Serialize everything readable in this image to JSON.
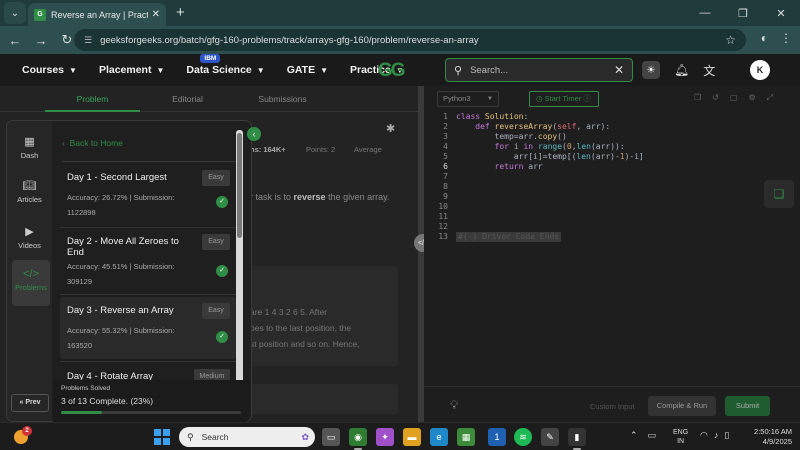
{
  "browser": {
    "tab_title": "Reverse an Array | Practice | Gee",
    "url": "geeksforgeeks.org/batch/gfg-160-problems/track/arrays-gfg-160/problem/reverse-an-array"
  },
  "header": {
    "nav": [
      {
        "label": "Courses"
      },
      {
        "label": "Placement"
      },
      {
        "label": "Data Science"
      },
      {
        "label": "GATE"
      },
      {
        "label": "Practice"
      }
    ],
    "ibm_badge": "IBM",
    "logo_text": "GG",
    "search_placeholder": "Search...",
    "avatar_letter": "K"
  },
  "problem": {
    "tabs": [
      "Problem",
      "Editorial",
      "Submissions"
    ],
    "submissions_label": "ns: 164K+",
    "points_label": "Points: 2",
    "average_label": "Average",
    "statement_pre": "r task is to ",
    "statement_bold": "reverse",
    "statement_post": " the given array.",
    "example_lines": [
      "are 1 4 3 2 6 5. After",
      "oes to the last position, the",
      "st position and so on. Hence,"
    ]
  },
  "editor": {
    "language": "Python3",
    "start_timer": "Start Timer",
    "line_numbers": [
      "1",
      "2",
      "3",
      "4",
      "5",
      "6",
      "7",
      "8",
      "9",
      "10",
      "11",
      "12",
      "13"
    ],
    "ghost_comment": "#{ } Driver Code Ends",
    "custom_input": "Custom Input",
    "compile_label": "Compile & Run",
    "submit_label": "Submit"
  },
  "overlay": {
    "side_nav": [
      {
        "label": "Dash"
      },
      {
        "label": "Articles"
      },
      {
        "label": "Videos"
      },
      {
        "label": "Problems"
      }
    ],
    "prev_label": "« Prev",
    "back_home": "Back to Home",
    "problems": [
      {
        "title": "Day 1 - Second Largest",
        "difficulty": "Easy",
        "accuracy": "Accuracy: 26.72% | Submission:",
        "submissions": "1122898",
        "solved": true
      },
      {
        "title": "Day 2 - Move All Zeroes to End",
        "difficulty": "Easy",
        "accuracy": "Accuracy: 45.51% | Submission:",
        "submissions": "309129",
        "solved": true
      },
      {
        "title": "Day 3 - Reverse an Array",
        "difficulty": "Easy",
        "accuracy": "Accuracy: 55.32% | Submission:",
        "submissions": "163520",
        "solved": true
      },
      {
        "title": "Day 4 - Rotate Array",
        "difficulty": "Medium",
        "accuracy": "",
        "submissions": "",
        "solved": false
      }
    ],
    "solved_label": "Problems Solved",
    "solved_text": "3 of 13 Complete. (23%)",
    "solved_percent": 23
  },
  "taskbar": {
    "weather_badge": "2",
    "search_label": "Search",
    "lang_line1": "ENG",
    "lang_line2": "IN",
    "time": "2:50:16 AM",
    "date": "4/9/2025"
  }
}
